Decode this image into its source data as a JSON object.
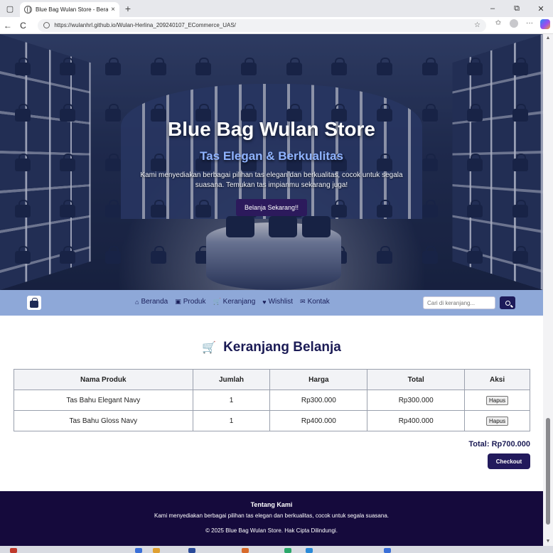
{
  "browser": {
    "tab_title": "Blue Bag Wulan Store - Beranda",
    "tab_close": "×",
    "new_tab": "+",
    "url": "https://wulanhrl.github.io/Wulan-Herlina_209240107_ECommerce_UAS/",
    "controls": {
      "minimize": "–",
      "restore": "⧉",
      "close": "✕"
    },
    "nav": {
      "back": "←",
      "reload": "C"
    }
  },
  "hero": {
    "title": "Blue Bag Wulan Store",
    "subtitle": "Tas Elegan & Berkualitas",
    "description": "Kami menyediakan berbagai pilihan tas elegan dan berkualitas, cocok untuk segala suasana. Temukan tas impianmu sekarang juga!",
    "cta_label": "Belanja Sekarang!!"
  },
  "navbar": {
    "links": [
      {
        "label": "Beranda",
        "icon": "home-icon",
        "glyph": "⌂"
      },
      {
        "label": "Produk",
        "icon": "bag-icon",
        "glyph": "▣"
      },
      {
        "label": "Keranjang",
        "icon": "cart-icon",
        "glyph": "🛒"
      },
      {
        "label": "Wishlist",
        "icon": "heart-icon",
        "glyph": "♥"
      },
      {
        "label": "Kontak",
        "icon": "mail-icon",
        "glyph": "✉"
      }
    ],
    "search_placeholder": "Cari di keranjang..."
  },
  "cart": {
    "title": "Keranjang Belanja",
    "headers": [
      "Nama Produk",
      "Jumlah",
      "Harga",
      "Total",
      "Aksi"
    ],
    "rows": [
      {
        "name": "Tas Bahu Elegant Navy",
        "qty": "1",
        "price": "Rp300.000",
        "total": "Rp300.000",
        "action": "Hapus"
      },
      {
        "name": "Tas Bahu Gloss Navy",
        "qty": "1",
        "price": "Rp400.000",
        "total": "Rp400.000",
        "action": "Hapus"
      }
    ],
    "grand_total": "Total: Rp700.000",
    "checkout_label": "Checkout"
  },
  "footer": {
    "title": "Tentang Kami",
    "description": "Kami menyediakan berbagai pilihan tas elegan dan berkualitas, cocok untuk segala suasana.",
    "copyright": "© 2025 Blue Bag Wulan Store. Hak Cipta Dilindungi."
  },
  "colors": {
    "navbar_bg": "#8ea8d8",
    "accent": "#221a5c",
    "footer_bg": "#150a3c",
    "subtitle": "#8fb3ff"
  }
}
